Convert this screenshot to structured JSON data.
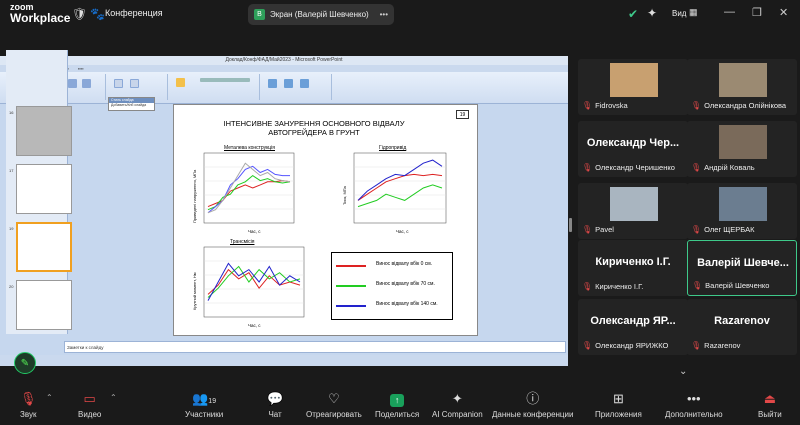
{
  "app": {
    "logo_line1": "zoom",
    "logo_line2": "Workplace",
    "meeting_label": "Конференция",
    "view_label": "Вид"
  },
  "share_pill": {
    "badge": "В",
    "text": "Экран (Валерій Шевченко)"
  },
  "ppt": {
    "window_title": "Доклад/Конф/ФАД/Май2023 - Microsoft PowerPoint",
    "notes_placeholder": "Заметки к слайду",
    "popup_title": "Стиль слайда",
    "popup_body": "Добавить/Кнб слайда",
    "slide_number": "19",
    "slide_title_1": "ІНТЕНСИВНЕ ЗАНУРЕННЯ ОСНОВНОГО ВІДВАЛУ",
    "slide_title_2": "АВТОГРЕЙДЕРА В ГРУНТ"
  },
  "chart_data": [
    {
      "type": "line",
      "title": "Металева конструкція",
      "ylabel": "Приведені напруження, МПа",
      "xlabel": "Час, с",
      "series": [
        {
          "color": "#d22",
          "values": [
            0.2,
            0.25,
            0.3,
            0.45,
            0.5,
            0.55,
            0.5,
            0.55,
            0.6,
            0.6,
            0.62,
            0.6
          ]
        },
        {
          "color": "#2c2",
          "values": [
            0.15,
            0.2,
            0.35,
            0.4,
            0.55,
            0.6,
            0.7,
            0.62,
            0.65,
            0.6,
            0.58,
            0.6
          ]
        },
        {
          "color": "#55f",
          "values": [
            0.1,
            0.2,
            0.3,
            0.55,
            0.65,
            0.8,
            0.85,
            0.75,
            0.8,
            0.72,
            0.7,
            0.7
          ]
        },
        {
          "color": "#aaa",
          "values": [
            0.1,
            0.15,
            0.3,
            0.5,
            0.7,
            0.9,
            0.8,
            0.7,
            0.75,
            0.65,
            0.62,
            0.6
          ]
        }
      ]
    },
    {
      "type": "line",
      "title": "Гідропривід",
      "ylabel": "Тиск, МПа",
      "xlabel": "Час, с",
      "series": [
        {
          "color": "#d22",
          "values": [
            0.3,
            0.4,
            0.5,
            0.6,
            0.65,
            0.7,
            0.72,
            0.7,
            0.72,
            0.7
          ]
        },
        {
          "color": "#2c2",
          "values": [
            0.2,
            0.25,
            0.3,
            0.4,
            0.35,
            0.3,
            0.4,
            0.5,
            0.55,
            0.5
          ]
        },
        {
          "color": "#22c",
          "values": [
            0.3,
            0.45,
            0.55,
            0.65,
            0.72,
            0.7,
            0.8,
            0.9,
            0.95,
            0.85
          ]
        }
      ]
    },
    {
      "type": "line",
      "title": "Трансмісія",
      "ylabel": "Крутний момент, Нм",
      "xlabel": "Час, с",
      "series": [
        {
          "color": "#d22",
          "values": [
            0.3,
            0.45,
            0.7,
            0.55,
            0.65,
            0.4,
            0.6,
            0.45,
            0.5,
            0.45
          ]
        },
        {
          "color": "#2c2",
          "values": [
            0.25,
            0.4,
            0.6,
            0.75,
            0.5,
            0.7,
            0.55,
            0.65,
            0.5,
            0.55
          ]
        },
        {
          "color": "#22c",
          "values": [
            0.2,
            0.5,
            0.8,
            0.6,
            0.7,
            0.5,
            0.75,
            0.45,
            0.6,
            0.5
          ]
        }
      ]
    }
  ],
  "legend": [
    {
      "text": "Винос відвалу вбік 0 см.",
      "color": "#d22"
    },
    {
      "text": "Винос відвалу вбік 70 см.",
      "color": "#2c2"
    },
    {
      "text": "Винос відвалу вбік 140 см.",
      "color": "#22c"
    }
  ],
  "participants": [
    {
      "name": "Fidrovska",
      "big": "",
      "has_video": true
    },
    {
      "name": "Олександра Олійнікова",
      "big": "",
      "has_video": true
    },
    {
      "name": "Олександр Черишенко",
      "big": "Олександр Чер...",
      "has_video": false
    },
    {
      "name": "Андрій Коваль",
      "big": "",
      "has_video": true
    },
    {
      "name": "Pavel",
      "big": "",
      "has_video": true
    },
    {
      "name": "Олег ЩЕРБАК",
      "big": "",
      "has_video": true
    },
    {
      "name": "Кириченко І.Г.",
      "big": "Кириченко І.Г.",
      "has_video": false
    },
    {
      "name": "Валерій Шевченко",
      "big": "Валерій Шевче...",
      "has_video": false
    },
    {
      "name": "Олександр ЯРИЖКО",
      "big": "Олександр ЯР...",
      "has_video": false
    },
    {
      "name": "Razarenov",
      "big": "Razarenov",
      "has_video": false
    }
  ],
  "toolbar": {
    "audio": "Звук",
    "video": "Видео",
    "participants": "Участники",
    "participants_count": "19",
    "chat": "Чат",
    "react": "Отреагировать",
    "share": "Поделиться",
    "ai": "AI Companion",
    "info": "Данные конференции",
    "apps": "Приложения",
    "more": "Дополнительно",
    "leave": "Выйти"
  },
  "colors": {
    "accent": "#3ec98a",
    "share_green": "#19a05b",
    "mute_red": "#e24848"
  }
}
